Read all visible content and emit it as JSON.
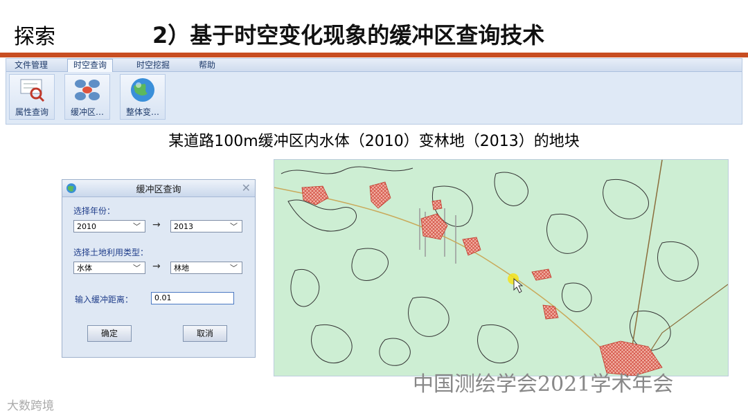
{
  "header": {
    "section": "探索",
    "title": "2）基于时空变化现象的缓冲区查询技术"
  },
  "ribbon": {
    "tabs": [
      "文件管理",
      "时空查询",
      "时空挖掘",
      "帮助"
    ],
    "active_tab": "时空查询",
    "buttons": [
      "属性查询",
      "缓冲区…",
      "整体变…"
    ]
  },
  "subtitle": "某道路100m缓冲区内水体（2010）变林地（2013）的地块",
  "dialog": {
    "title": "缓冲区查询",
    "year_label": "选择年份：",
    "year_from": "2010",
    "year_to": "2013",
    "type_label": "选择土地利用类型：",
    "type_from": "水体",
    "type_to": "林地",
    "distance_label": "输入缓冲距离：",
    "distance_value": "0.01",
    "ok": "确定",
    "cancel": "取消"
  },
  "watermark": "中国测绘学会2021学术年会",
  "logo": "大数跨境",
  "colors": {
    "accent_bar": "#c84e22",
    "map_bg": "#cdeed3",
    "patch": "#f2b3a6"
  }
}
